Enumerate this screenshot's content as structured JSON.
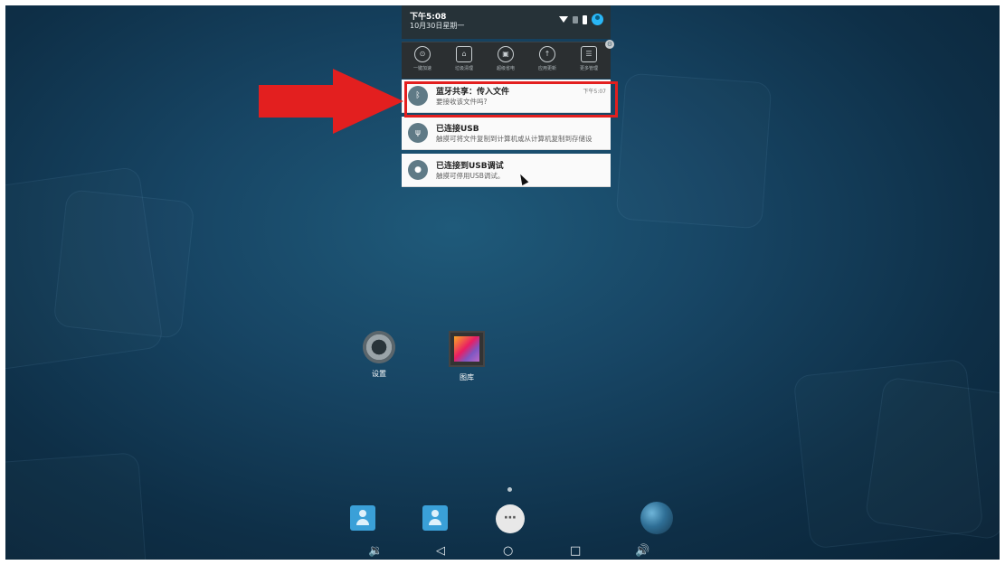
{
  "status_bar": {
    "time": "下午5:08",
    "date": "10月30日星期一"
  },
  "quick_settings": [
    {
      "label": "一键加速",
      "icon": "speed-icon"
    },
    {
      "label": "垃圾清理",
      "icon": "trash-icon"
    },
    {
      "label": "超级省电",
      "icon": "battery-saver-icon"
    },
    {
      "label": "应用更新",
      "icon": "update-icon"
    },
    {
      "label": "更多管理",
      "icon": "manage-icon"
    }
  ],
  "notifications": [
    {
      "title": "蓝牙共享：传入文件",
      "text": "要接收该文件吗?",
      "time": "下午5:07",
      "icon": "bluetooth-icon"
    },
    {
      "title": "已连接USB",
      "text": "触摸可将文件复制到计算机或从计算机复制到存储设",
      "icon": "usb-icon"
    },
    {
      "title": "已连接到USB调试",
      "text": "触摸可停用USB调试。",
      "icon": "debug-icon"
    }
  ],
  "apps": {
    "settings": "设置",
    "gallery": "图库"
  },
  "colors": {
    "highlight": "#e31f1f",
    "wallpaper": "#174564"
  }
}
